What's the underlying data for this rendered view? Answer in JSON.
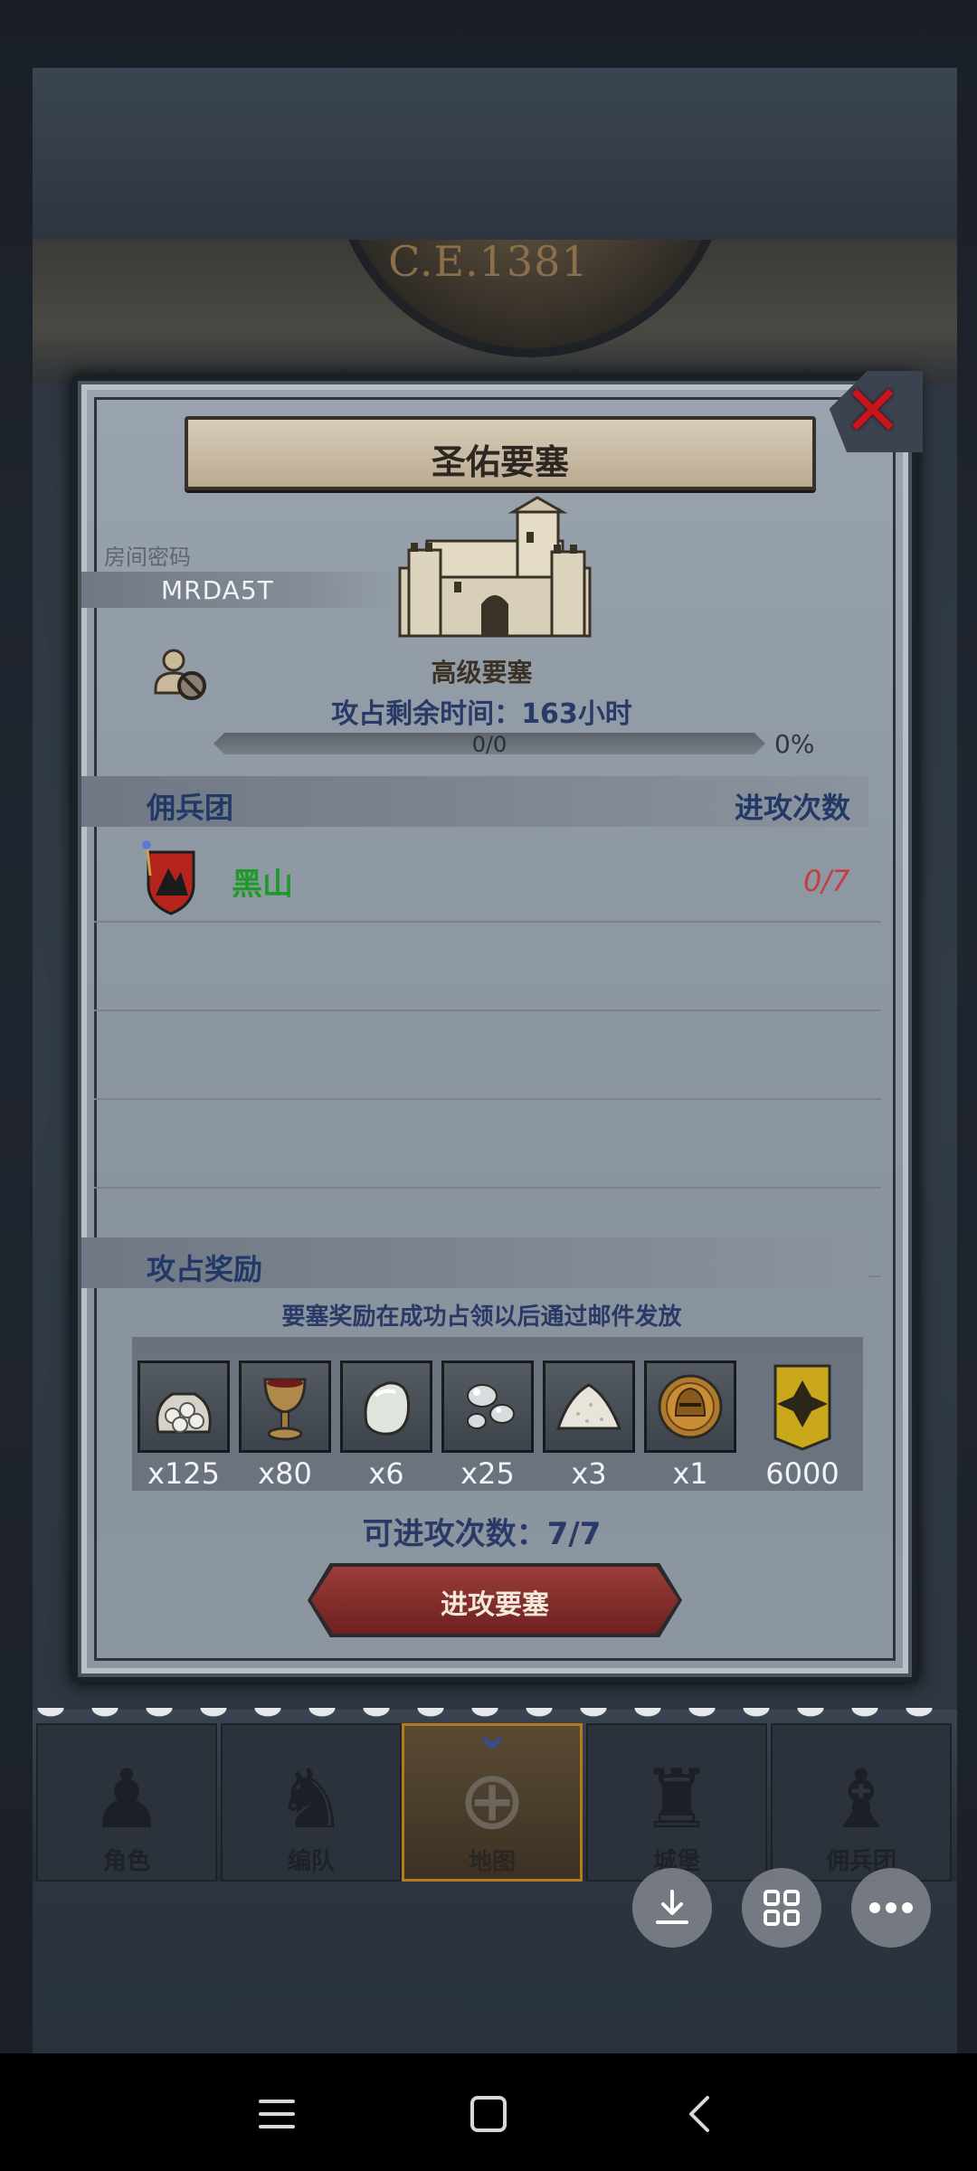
{
  "header": {
    "era": "C.E.1381"
  },
  "dialog": {
    "title": "圣佑要塞",
    "room_label": "房间密码",
    "room_code": "MRDA5T",
    "fortress_grade": "高级要塞",
    "time_label": "攻占剩余时间：",
    "time_value": "163",
    "time_unit": "小时",
    "progress_count": "0/0",
    "progress_percent": "0%",
    "progress_fraction": 0,
    "mercenary_header": "佣兵团",
    "attack_count_header": "进攻次数",
    "guilds": [
      {
        "name": "黑山",
        "attacks": "0/7"
      }
    ],
    "reward_header": "攻占奖励",
    "reward_note": "要塞奖励在成功占领以后通过邮件发放",
    "rewards": [
      {
        "icon": "silver-bag-icon",
        "qty": "x125"
      },
      {
        "icon": "goblet-icon",
        "qty": "x80"
      },
      {
        "icon": "moonstone-icon",
        "qty": "x6"
      },
      {
        "icon": "silver-pearls-icon",
        "qty": "x25"
      },
      {
        "icon": "salt-pile-icon",
        "qty": "x3"
      },
      {
        "icon": "helmet-medal-icon",
        "qty": "x1"
      },
      {
        "icon": "banner-icon",
        "qty": "6000"
      }
    ],
    "attacks_left_label": "可进攻次数：",
    "attacks_left_value": "7/7",
    "attack_button": "进攻要塞"
  },
  "bottom_nav": {
    "tabs": [
      {
        "label": "角色",
        "icon": "character-icon",
        "active": false
      },
      {
        "label": "编队",
        "icon": "knight-icon",
        "active": false
      },
      {
        "label": "地图",
        "icon": "map-compass-icon",
        "active": true
      },
      {
        "label": "城堡",
        "icon": "castle-icon",
        "active": false
      },
      {
        "label": "佣兵团",
        "icon": "mercenary-icon",
        "active": false
      }
    ]
  },
  "floating_buttons": [
    "download-icon",
    "grid-icon",
    "more-icon"
  ],
  "system_bar": [
    "menu-icon",
    "home-icon",
    "back-icon"
  ],
  "colors": {
    "title_blue": "#2a3a66",
    "guild_green": "#1e9a28",
    "attack_red": "#c14040",
    "button_red": "#9a3d3a",
    "active_tab_gold": "#b57a1a"
  }
}
